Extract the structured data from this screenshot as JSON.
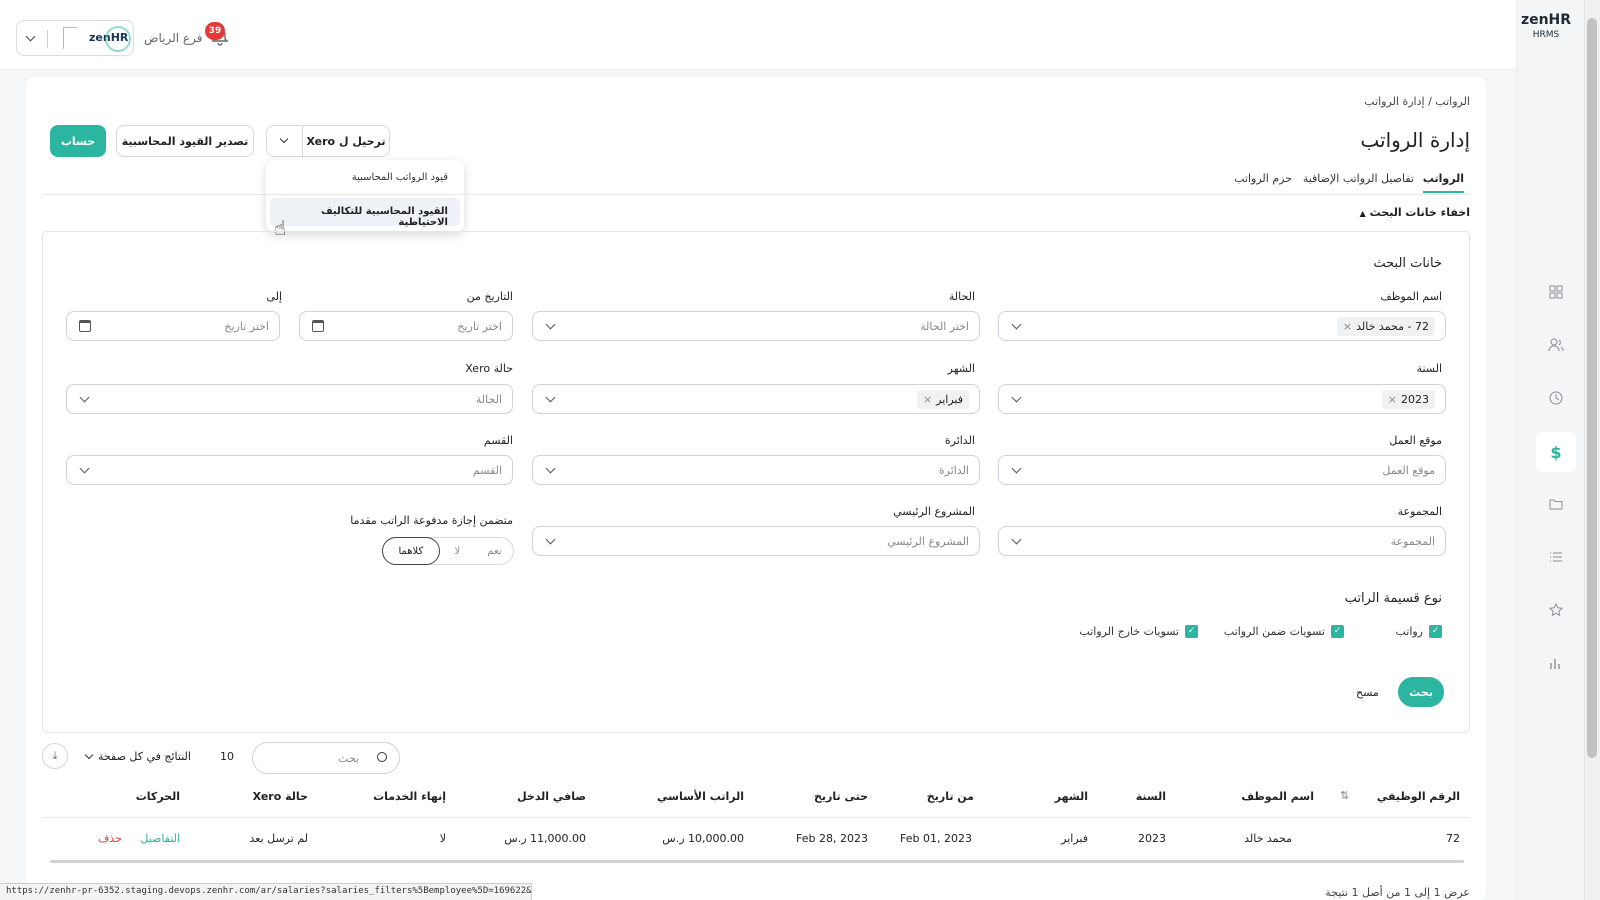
{
  "app": {
    "brand": "zenHR",
    "brand_sub": "HRMS",
    "logo_small": "zenHR"
  },
  "topbar": {
    "branch": "فرع الرياض",
    "notifications_count": "39"
  },
  "breadcrumb": {
    "root": "الرواتب",
    "sep": "/",
    "current": "إدارة الرواتب"
  },
  "page_title": "إدارة الرواتب",
  "actions": {
    "calculate": "حساب",
    "export": "تصدير القيود المحاسبية",
    "post_xero": "ترحيل ل Xero"
  },
  "dropdown": {
    "items": [
      "قيود الرواتب المحاسبية",
      "القيود المحاسبية للتكاليف الاحتياطية"
    ]
  },
  "tabs": [
    "الرواتب",
    "تفاصيل الرواتب الإضافية",
    "حزم الرواتب"
  ],
  "toggle_search": "اخفاء خانات البحث",
  "search": {
    "title": "خانات البحث",
    "employee_name": {
      "label": "اسم الموظف",
      "value": "72 - محمد خالد"
    },
    "status": {
      "label": "الحالة",
      "placeholder": "اختر الحالة"
    },
    "date_from": {
      "label": "التاريخ من",
      "placeholder": "اختر تاريخ"
    },
    "date_to": {
      "label": "إلى",
      "placeholder": "اختر تاريخ"
    },
    "year": {
      "label": "السنة",
      "value": "2023"
    },
    "month": {
      "label": "الشهر",
      "value": "فبراير"
    },
    "xero_status": {
      "label": "حالة Xero",
      "placeholder": "الحالة"
    },
    "work_location": {
      "label": "موقع العمل",
      "placeholder": "موقع العمل"
    },
    "department": {
      "label": "الدائرة",
      "placeholder": "الدائرة"
    },
    "section": {
      "label": "القسم",
      "placeholder": "القسم"
    },
    "group": {
      "label": "المجموعة",
      "placeholder": "المجموعة"
    },
    "main_project": {
      "label": "المشروع الرئيسي",
      "placeholder": "المشروع الرئيسي"
    },
    "prepaid_leave": {
      "label": "متضمن إجازة مدفوعة الراتب مقدما",
      "options": [
        "نعم",
        "لا",
        "كلاهما"
      ]
    },
    "slip_type": {
      "label": "نوع قسيمة الراتب",
      "options": [
        "رواتب",
        "تسويات ضمن الرواتب",
        "تسويات خارج الرواتب"
      ]
    },
    "search_btn": "بحث",
    "clear_btn": "مسح"
  },
  "table_controls": {
    "search_placeholder": "بحث",
    "per_page": "10",
    "per_page_label": "النتائج في كل صفحة"
  },
  "table": {
    "headers": [
      "الرقم الوظيفي",
      "اسم الموظف",
      "السنة",
      "الشهر",
      "من تاريخ",
      "حتى تاريخ",
      "الراتب الأساسي",
      "صافي الدخل",
      "إنهاء الخدمات",
      "حالة Xero",
      "الحركات"
    ],
    "rows": [
      {
        "emp_no": "72",
        "name": "محمد خالد",
        "year": "2023",
        "month": "فبراير",
        "from": "Feb 01, 2023",
        "to": "Feb 28, 2023",
        "basic": "10,000.00 ر.س",
        "net": "11,000.00 ر.س",
        "eos": "لا",
        "xero": "لم ترسل بعد",
        "details": "التفاصيل",
        "delete": "حذف"
      }
    ]
  },
  "footer": {
    "summary": "عرض 1 إلى 1 من أصل 1 نتيجة",
    "status_url": "https://zenhr-pr-6352.staging.devops.zenhr.com/ar/salaries?salaries_filters%5Bemployee%5D=169622&salaries_filter..."
  },
  "colors": {
    "accent": "#2cb5a0",
    "danger": "#e53935",
    "badge": "#e53935"
  }
}
